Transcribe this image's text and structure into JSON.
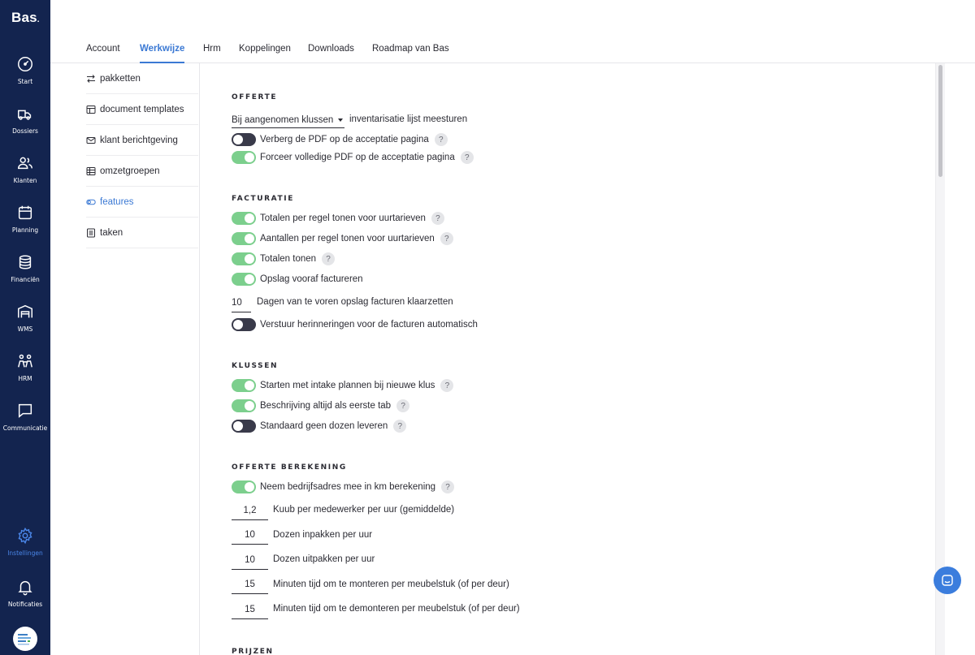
{
  "app": {
    "logo": "Bas",
    "logo_dot": "."
  },
  "nav": {
    "items": [
      {
        "label": "Start",
        "icon": "gauge-icon"
      },
      {
        "label": "Dossiers",
        "icon": "moving-truck-icon"
      },
      {
        "label": "Klanten",
        "icon": "users-icon"
      },
      {
        "label": "Planning",
        "icon": "calendar-icon"
      },
      {
        "label": "Financiën",
        "icon": "coins-icon"
      },
      {
        "label": "WMS",
        "icon": "warehouse-icon"
      },
      {
        "label": "HRM",
        "icon": "team-icon"
      },
      {
        "label": "Communicatie",
        "icon": "chat-bubble-icon"
      },
      {
        "label": "Instellingen",
        "icon": "gear-icon"
      },
      {
        "label": "Notificaties",
        "icon": "bell-icon"
      }
    ],
    "active": "Instellingen"
  },
  "tabs": [
    "Account",
    "Werkwijze",
    "Hrm",
    "Koppelingen",
    "Downloads",
    "Roadmap van Bas"
  ],
  "active_tab": "Werkwijze",
  "submenu": [
    {
      "label": "pakketten",
      "icon": "swap-icon"
    },
    {
      "label": "document templates",
      "icon": "template-icon"
    },
    {
      "label": "klant berichtgeving",
      "icon": "mail-icon"
    },
    {
      "label": "omzetgroepen",
      "icon": "table-icon"
    },
    {
      "label": "features",
      "icon": "toggle-icon"
    },
    {
      "label": "taken",
      "icon": "checklist-icon"
    }
  ],
  "active_submenu": "features",
  "offerte": {
    "title": "OFFERTE",
    "select_value": "Bij aangenomen klussen",
    "select_suffix": "inventarisatie lijst meesturen",
    "toggles": [
      {
        "label": "Verberg de PDF op de acceptatie pagina",
        "on": false,
        "help": "?"
      },
      {
        "label": "Forceer volledige PDF op de acceptatie pagina",
        "on": true,
        "help": "?"
      }
    ]
  },
  "facturatie": {
    "title": "FACTURATIE",
    "toggles": [
      {
        "label": "Totalen per regel tonen voor uurtarieven",
        "on": true,
        "help": "?"
      },
      {
        "label": "Aantallen per regel tonen voor uurtarieven",
        "on": true,
        "help": "?"
      },
      {
        "label": "Totalen tonen",
        "on": true,
        "help": "?"
      },
      {
        "label": "Opslag vooraf factureren",
        "on": true,
        "help": ""
      }
    ],
    "days_value": "10",
    "days_label": "Dagen van te voren opslag facturen klaarzetten",
    "reminder": {
      "label": "Verstuur herinneringen voor de facturen automatisch",
      "on": false
    }
  },
  "klussen": {
    "title": "KLUSSEN",
    "toggles": [
      {
        "label": "Starten met intake plannen bij nieuwe klus",
        "on": true,
        "help": "?"
      },
      {
        "label": "Beschrijving altijd als eerste tab",
        "on": true,
        "help": "?"
      },
      {
        "label": "Standaard geen dozen leveren",
        "on": false,
        "help": "?"
      }
    ]
  },
  "berekening": {
    "title": "OFFERTE BEREKENING",
    "toggle": {
      "label": "Neem bedrijfsadres mee in km berekening",
      "on": true,
      "help": "?"
    },
    "inputs": [
      {
        "value": "1,2",
        "label": "Kuub per medewerker per uur (gemiddelde)"
      },
      {
        "value": "10",
        "label": "Dozen inpakken per uur"
      },
      {
        "value": "10",
        "label": "Dozen uitpakken per uur"
      },
      {
        "value": "15",
        "label": "Minuten tijd om te monteren per meubelstuk (of per deur)"
      },
      {
        "value": "15",
        "label": "Minuten tijd om te demonteren per meubelstuk (of per deur)"
      }
    ]
  },
  "prijzen": {
    "title": "PRIJZEN"
  },
  "colors": {
    "nav_bg": "#13244f",
    "accent": "#3b79d4",
    "toggle_on": "#7ccf8d",
    "toggle_off": "#393a4a"
  }
}
